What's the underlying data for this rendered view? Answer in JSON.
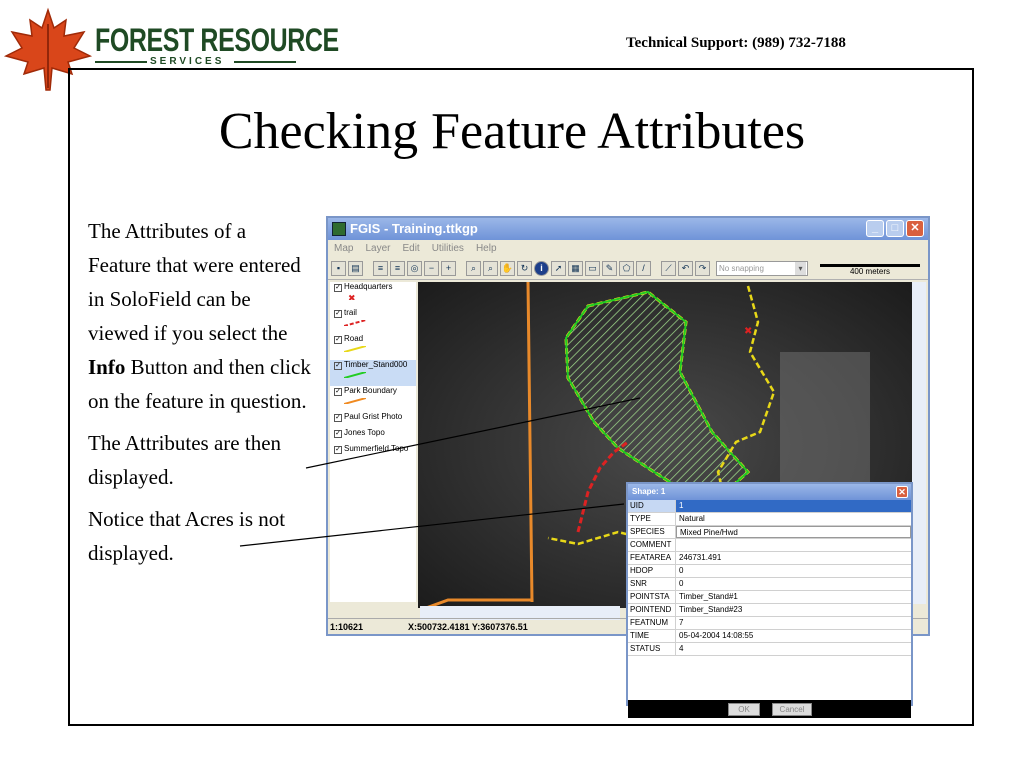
{
  "header": {
    "logo_name": "FOREST RESOURCE",
    "logo_sub": "SERVICES",
    "support": "Technical Support: (989) 732-7188"
  },
  "slide": {
    "title": "Checking Feature Attributes",
    "para1_a": "The Attributes of a Feature that were entered in SoloField can be viewed if you select the ",
    "para1_bold": "Info",
    "para1_b": " Button and then click on the feature in question.",
    "para2": "The Attributes are then displayed.",
    "para3": "Notice that Acres is not displayed."
  },
  "app": {
    "title": "FGIS - Training.ttkgp",
    "menu": [
      "Map",
      "Layer",
      "Edit",
      "Utilities",
      "Help"
    ],
    "snapping": "No snapping",
    "scale_label": "400 meters",
    "layers": [
      {
        "label": "Headquarters",
        "color": "#dd2222"
      },
      {
        "label": "trail",
        "color": "#dd2222"
      },
      {
        "label": "Road",
        "color": "#f0e020"
      },
      {
        "label": "Timber_Stand000",
        "color": "#22cc22"
      },
      {
        "label": "Park Boundary",
        "color": "#f08a20"
      },
      {
        "label": "Paul Grist Photo",
        "color": ""
      },
      {
        "label": "Jones Topo",
        "color": ""
      },
      {
        "label": "Summerfield Topo",
        "color": ""
      }
    ],
    "status_scale": "1:10621",
    "status_coords": "X:500732.4181 Y:3607376.51"
  },
  "attributes": {
    "title": "Shape: 1",
    "rows": [
      {
        "key": "UID",
        "value": "1"
      },
      {
        "key": "TYPE",
        "value": "Natural"
      },
      {
        "key": "SPECIES",
        "value": "Mixed Pine/Hwd"
      },
      {
        "key": "COMMENT",
        "value": ""
      },
      {
        "key": "FEATAREA",
        "value": "246731.491"
      },
      {
        "key": "HDOP",
        "value": "0"
      },
      {
        "key": "SNR",
        "value": "0"
      },
      {
        "key": "POINTSTA",
        "value": "Timber_Stand#1"
      },
      {
        "key": "POINTEND",
        "value": "Timber_Stand#23"
      },
      {
        "key": "FEATNUM",
        "value": "7"
      },
      {
        "key": "TIME",
        "value": "05-04-2004 14:08:55"
      },
      {
        "key": "STATUS",
        "value": "4"
      }
    ],
    "ok": "OK",
    "cancel": "Cancel"
  }
}
